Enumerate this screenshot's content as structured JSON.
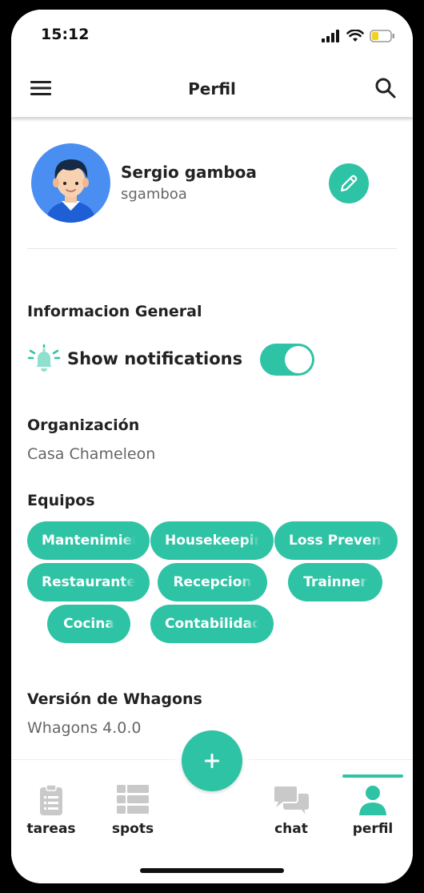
{
  "status_bar": {
    "time": "15:12"
  },
  "header": {
    "title": "Perfil",
    "menu_icon": "hamburger-menu-icon",
    "search_icon": "search-icon"
  },
  "profile": {
    "name": "Sergio gamboa",
    "username": "sgamboa",
    "edit_icon": "pencil-icon"
  },
  "general": {
    "title": "Informacion General",
    "notifications": {
      "label": "Show notifications",
      "enabled": true,
      "icon": "bell-icon"
    },
    "organization": {
      "label": "Organización",
      "value": "Casa Chameleon"
    },
    "teams": {
      "label": "Equipos",
      "items": [
        "Mantenimiento",
        "Housekeeping",
        "Loss Prevention",
        "Restaurante",
        "Recepcion",
        "Trainner",
        "Cocina",
        "Contabilidad"
      ]
    },
    "version": {
      "label": "Versión de Whagons",
      "value": "Whagons 4.0.0"
    }
  },
  "tab_bar": {
    "tabs": [
      {
        "label": "tareas",
        "icon": "clipboard-icon"
      },
      {
        "label": "spots",
        "icon": "grid-list-icon"
      },
      {
        "label": "chat",
        "icon": "chat-icon"
      },
      {
        "label": "perfil",
        "icon": "person-icon",
        "active": true
      }
    ],
    "fab_label": "+",
    "fab_icon": "plus-icon"
  },
  "colors": {
    "accent": "#2fc3a5",
    "avatar_bg": "#4a8ef2"
  }
}
